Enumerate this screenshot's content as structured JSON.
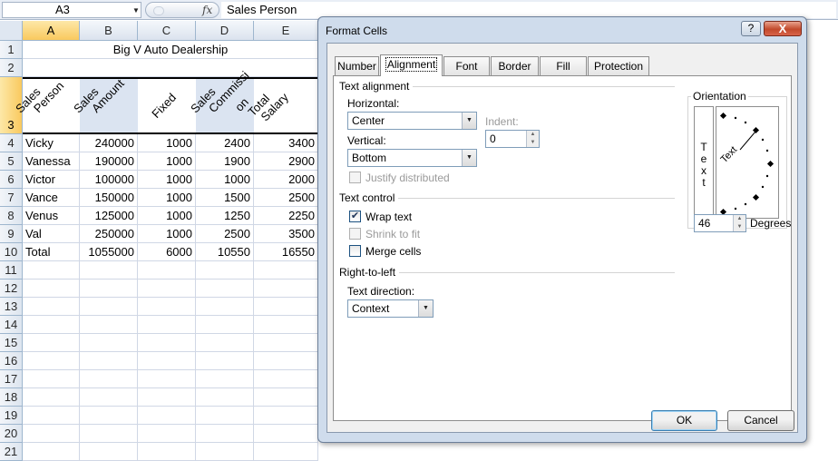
{
  "formula_bar": {
    "name_box": "A3",
    "fx_label": "fx",
    "formula": "Sales Person"
  },
  "columns": [
    "A",
    "B",
    "C",
    "D",
    "E"
  ],
  "rows": [
    "1",
    "2",
    "3",
    "4",
    "5",
    "6",
    "7",
    "8",
    "9",
    "10",
    "11",
    "12",
    "13",
    "14",
    "15",
    "16",
    "17",
    "18",
    "19",
    "20",
    "21"
  ],
  "sheet": {
    "title": "Big V Auto Dealership",
    "headers": [
      [
        "Sales",
        "Person"
      ],
      [
        "Sales",
        "Amount"
      ],
      [
        "Fixed"
      ],
      [
        "Sales",
        "Commissi"
      ],
      [
        "on",
        "Total",
        "Salary"
      ]
    ],
    "data": [
      [
        "Vicky",
        "240000",
        "1000",
        "2400",
        "3400"
      ],
      [
        "Vanessa",
        "190000",
        "1000",
        "1900",
        "2900"
      ],
      [
        "Victor",
        "100000",
        "1000",
        "1000",
        "2000"
      ],
      [
        "Vance",
        "150000",
        "1000",
        "1500",
        "2500"
      ],
      [
        "Venus",
        "125000",
        "1000",
        "1250",
        "2250"
      ],
      [
        "Val",
        "250000",
        "1000",
        "2500",
        "3500"
      ],
      [
        "Total",
        "1055000",
        "6000",
        "10550",
        "16550"
      ]
    ]
  },
  "dialog": {
    "title": "Format Cells",
    "help": "?",
    "close": "X",
    "tabs": [
      "Number",
      "Alignment",
      "Font",
      "Border",
      "Fill",
      "Protection"
    ],
    "active_tab": "Alignment",
    "text_alignment": {
      "group": "Text alignment",
      "horizontal_label": "Horizontal:",
      "horizontal_value": "Center",
      "vertical_label": "Vertical:",
      "vertical_value": "Bottom",
      "indent_label": "Indent:",
      "indent_value": "0",
      "justify_distributed": "Justify distributed"
    },
    "text_control": {
      "group": "Text control",
      "wrap_text": "Wrap text",
      "wrap_checked": true,
      "shrink_to_fit": "Shrink to fit",
      "merge_cells": "Merge cells"
    },
    "rtl": {
      "group": "Right-to-left",
      "direction_label": "Text direction:",
      "direction_value": "Context"
    },
    "orientation": {
      "group": "Orientation",
      "vertical_text": "T\ne\nx\nt",
      "dial_text": "Text",
      "degrees_value": "46",
      "degrees_label": "Degrees"
    },
    "ok": "OK",
    "cancel": "Cancel"
  }
}
